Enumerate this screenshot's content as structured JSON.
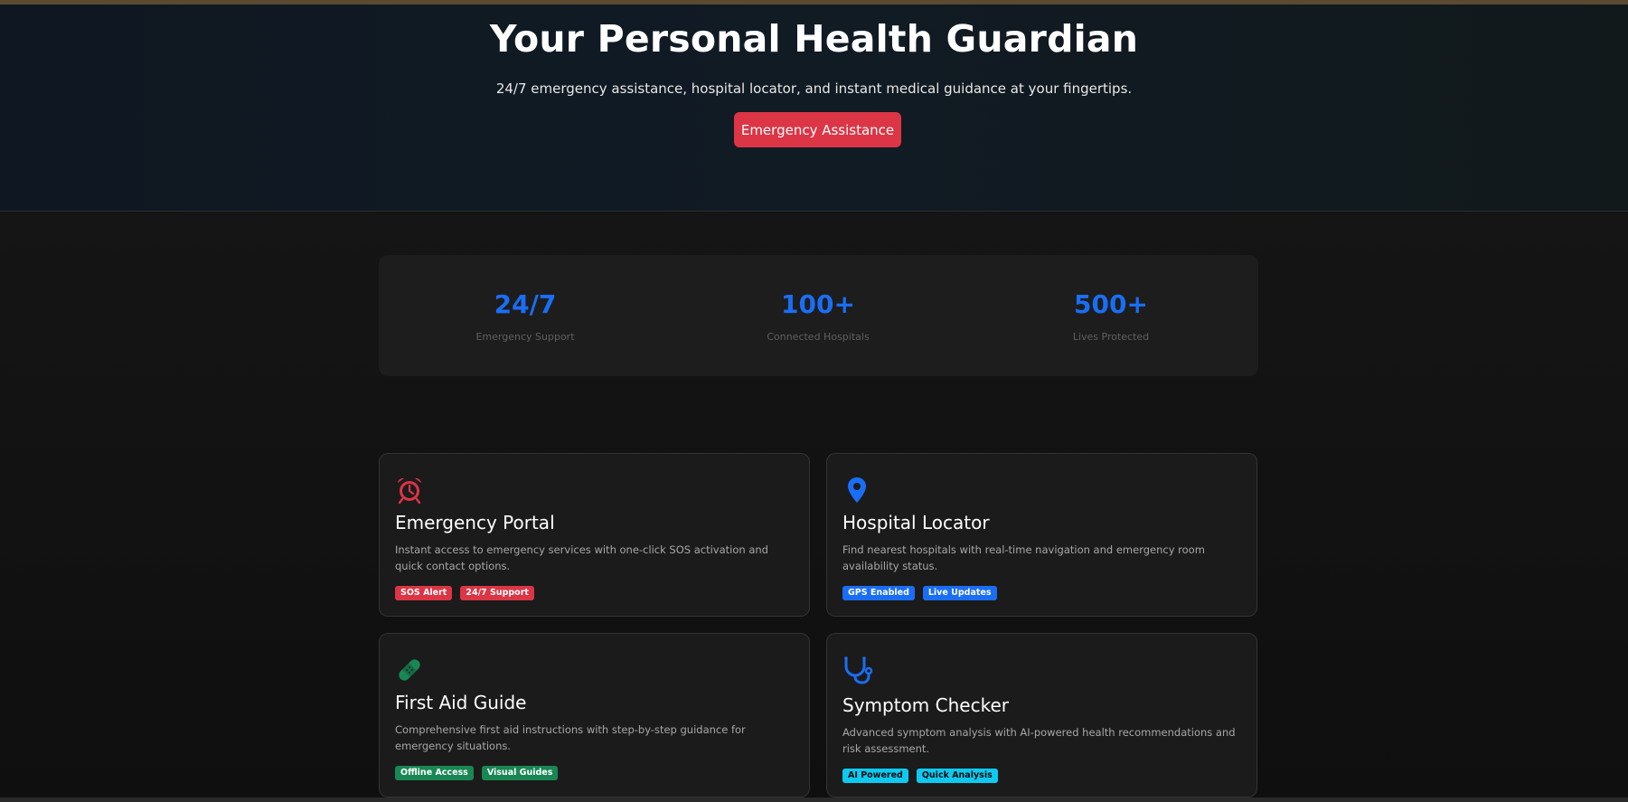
{
  "hero": {
    "title": "Your Personal Health Guardian",
    "subtitle": "24/7 emergency assistance, hospital locator, and instant medical guidance at your fingertips.",
    "cta_label": "Emergency Assistance"
  },
  "stats": [
    {
      "value": "24/7",
      "label": "Emergency Support"
    },
    {
      "value": "100+",
      "label": "Connected Hospitals"
    },
    {
      "value": "500+",
      "label": "Lives Protected"
    }
  ],
  "cards": [
    {
      "icon": "alarm-clock-icon",
      "title": "Emergency Portal",
      "description": "Instant access to emergency services with one-click SOS activation and quick contact options.",
      "tags": [
        "SOS Alert",
        "24/7 Support"
      ],
      "color": "#dc3545"
    },
    {
      "icon": "map-pin-icon",
      "title": "Hospital Locator",
      "description": "Find nearest hospitals with real-time navigation and emergency room availability status.",
      "tags": [
        "GPS Enabled",
        "Live Updates"
      ],
      "color": "#1a6ef5"
    },
    {
      "icon": "bandage-icon",
      "title": "First Aid Guide",
      "description": "Comprehensive first aid instructions with step-by-step guidance for emergency situations.",
      "tags": [
        "Offline Access",
        "Visual Guides"
      ],
      "color": "#198754"
    },
    {
      "icon": "stethoscope-icon",
      "title": "Symptom Checker",
      "description": "Advanced symptom analysis with AI-powered health recommendations and risk assessment.",
      "tags": [
        "AI Powered",
        "Quick Analysis"
      ],
      "color": "#0dcaf0"
    }
  ],
  "colors": {
    "accent_blue": "#1a6ef5",
    "danger_red": "#dc3545",
    "success_green": "#198754",
    "info_cyan": "#0dcaf0"
  }
}
